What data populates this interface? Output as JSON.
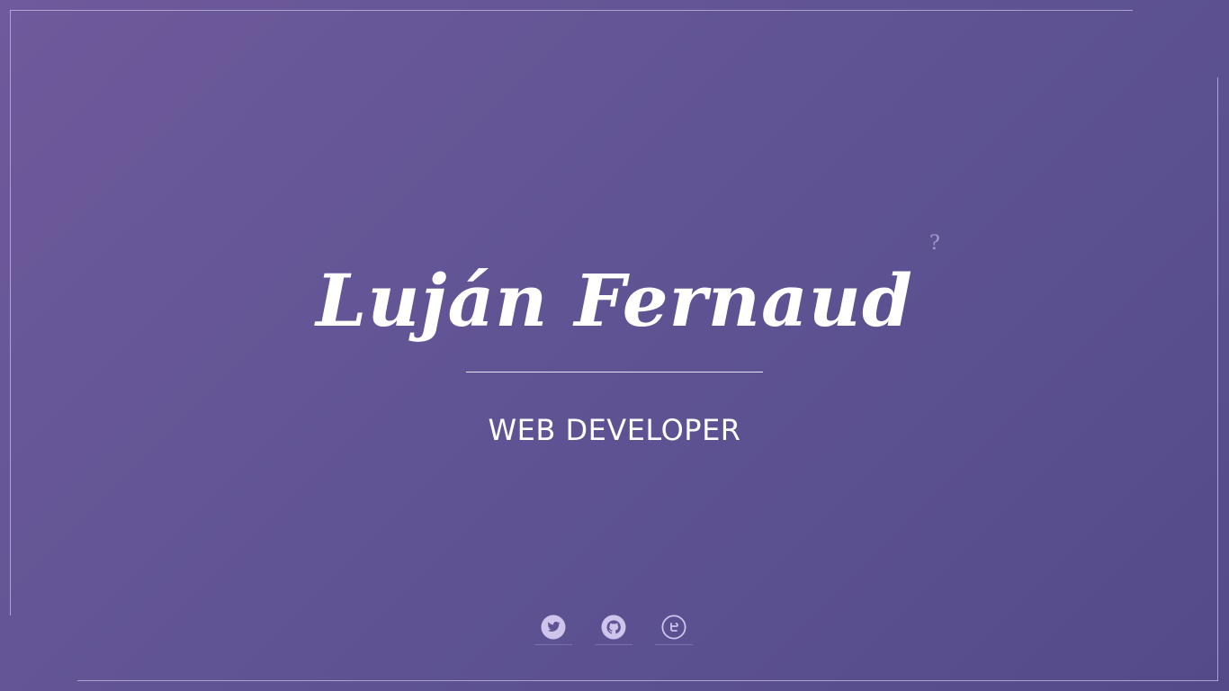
{
  "hero": {
    "name": "Luján Fernaud",
    "role": "WEB DEVELOPER",
    "help_label": "?"
  },
  "social": [
    {
      "icon": "twitter-icon",
      "label": "Twitter"
    },
    {
      "icon": "github-icon",
      "label": "GitHub"
    },
    {
      "icon": "codepen-icon",
      "label": "CodePen"
    }
  ],
  "colors": {
    "background_start": "#6e5a9c",
    "background_end": "#544a8a",
    "text": "#ffffff",
    "icon": "#cfc4ec",
    "frame": "#c8b9eb"
  }
}
